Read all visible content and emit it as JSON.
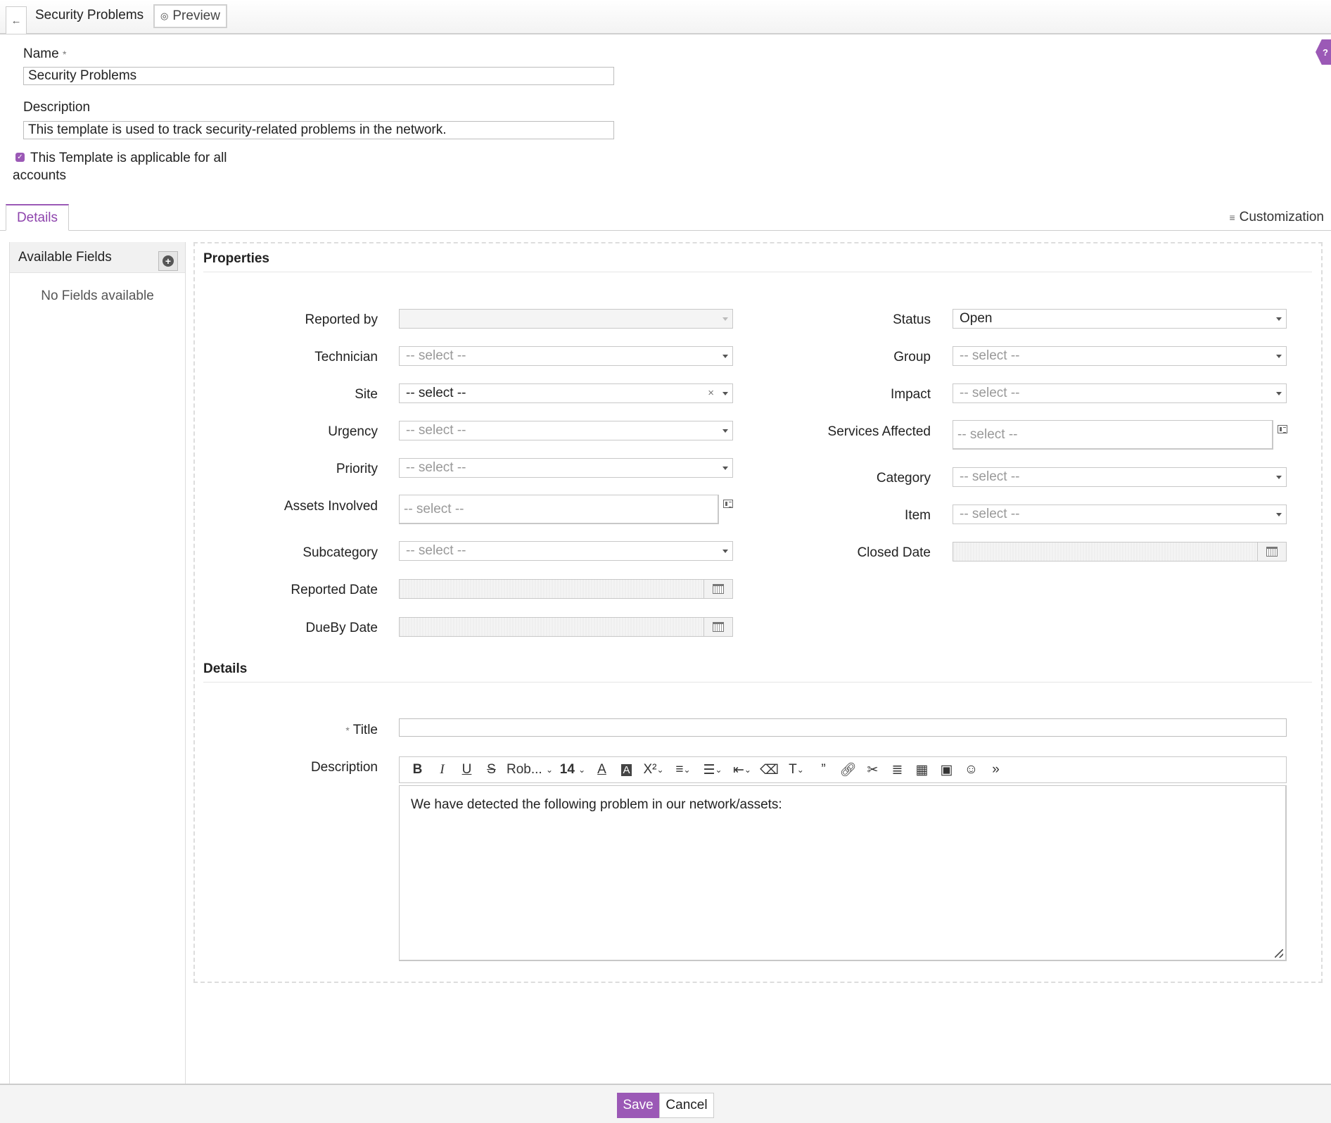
{
  "header": {
    "title": "Security Problems",
    "preview_label": "Preview"
  },
  "template_form": {
    "name_label": "Name",
    "name_value": "Security Problems",
    "description_label": "Description",
    "description_value": "This template is used to track security-related problems in the network.",
    "all_accounts_label": "This Template is applicable for all accounts",
    "all_accounts_checked": true
  },
  "tabs": {
    "details": "Details",
    "customization": "Customization"
  },
  "available_fields": {
    "title": "Available Fields",
    "empty_text": "No Fields available"
  },
  "properties": {
    "section_title": "Properties",
    "left": {
      "reported_by": {
        "label": "Reported by",
        "value": ""
      },
      "technician": {
        "label": "Technician",
        "value": "-- select --"
      },
      "site": {
        "label": "Site",
        "value": "-- select --"
      },
      "urgency": {
        "label": "Urgency",
        "value": "-- select --"
      },
      "priority": {
        "label": "Priority",
        "value": "-- select --"
      },
      "assets_involved": {
        "label": "Assets Involved",
        "value": "-- select --"
      },
      "subcategory": {
        "label": "Subcategory",
        "value": "-- select --"
      },
      "reported_date": {
        "label": "Reported Date"
      },
      "dueby_date": {
        "label": "DueBy Date"
      }
    },
    "right": {
      "status": {
        "label": "Status",
        "value": "Open"
      },
      "group": {
        "label": "Group",
        "value": "-- select --"
      },
      "impact": {
        "label": "Impact",
        "value": "-- select --"
      },
      "services_affected": {
        "label": "Services Affected",
        "value": "-- select --"
      },
      "category": {
        "label": "Category",
        "value": "-- select --"
      },
      "item": {
        "label": "Item",
        "value": "-- select --"
      },
      "closed_date": {
        "label": "Closed Date"
      }
    }
  },
  "details": {
    "section_title": "Details",
    "title_label": "Title",
    "title_value": "",
    "description_label": "Description",
    "description_text": "We have detected the following problem in our network/assets:",
    "toolbar": {
      "font_name": "Rob...",
      "font_size": "14"
    }
  },
  "footer": {
    "save": "Save",
    "cancel": "Cancel"
  },
  "colors": {
    "accent": "#9b59b6"
  }
}
